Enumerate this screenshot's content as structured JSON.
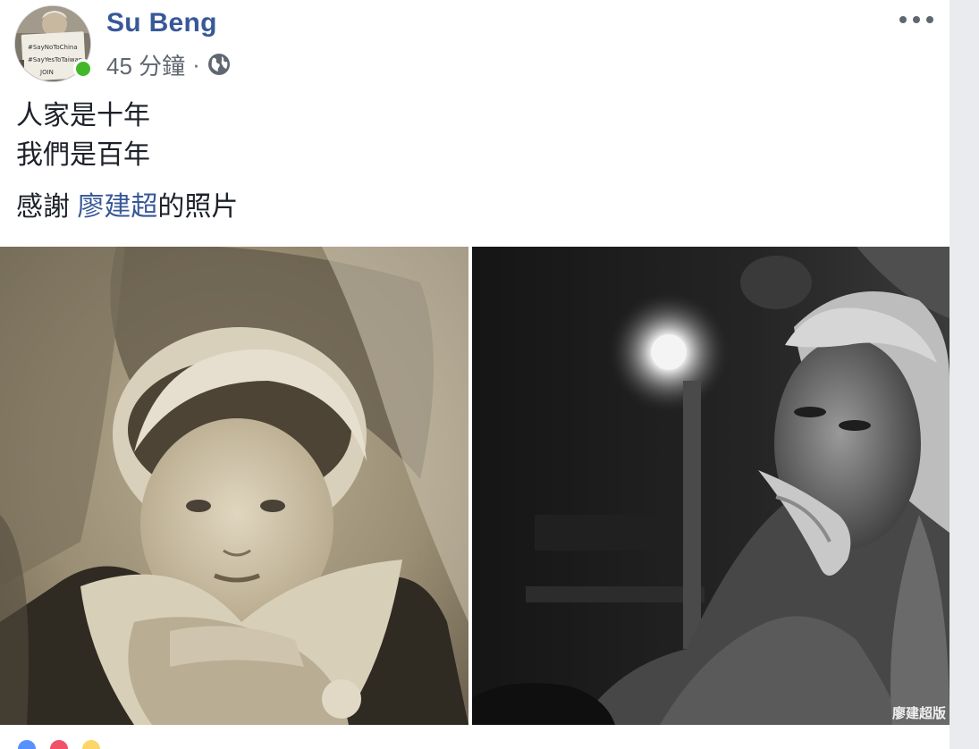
{
  "post": {
    "author": "Su Beng",
    "time": "45 分鐘",
    "separator": "·",
    "privacy_icon": "globe-icon",
    "more_icon": "more-options-icon",
    "text_lines": [
      "人家是十年",
      "我們是百年"
    ],
    "credit": {
      "prefix": "感謝 ",
      "mention": "廖建超",
      "suffix": "的照片"
    },
    "photos": [
      {
        "name": "baby-photo",
        "description_icon": "sepia-baby-photo"
      },
      {
        "name": "elder-photo",
        "watermark": "廖建超版"
      }
    ]
  },
  "colors": {
    "link": "#385898",
    "text": "#1d2129",
    "meta": "#616770",
    "online": "#42b72a",
    "rail": "#e9ebee"
  }
}
